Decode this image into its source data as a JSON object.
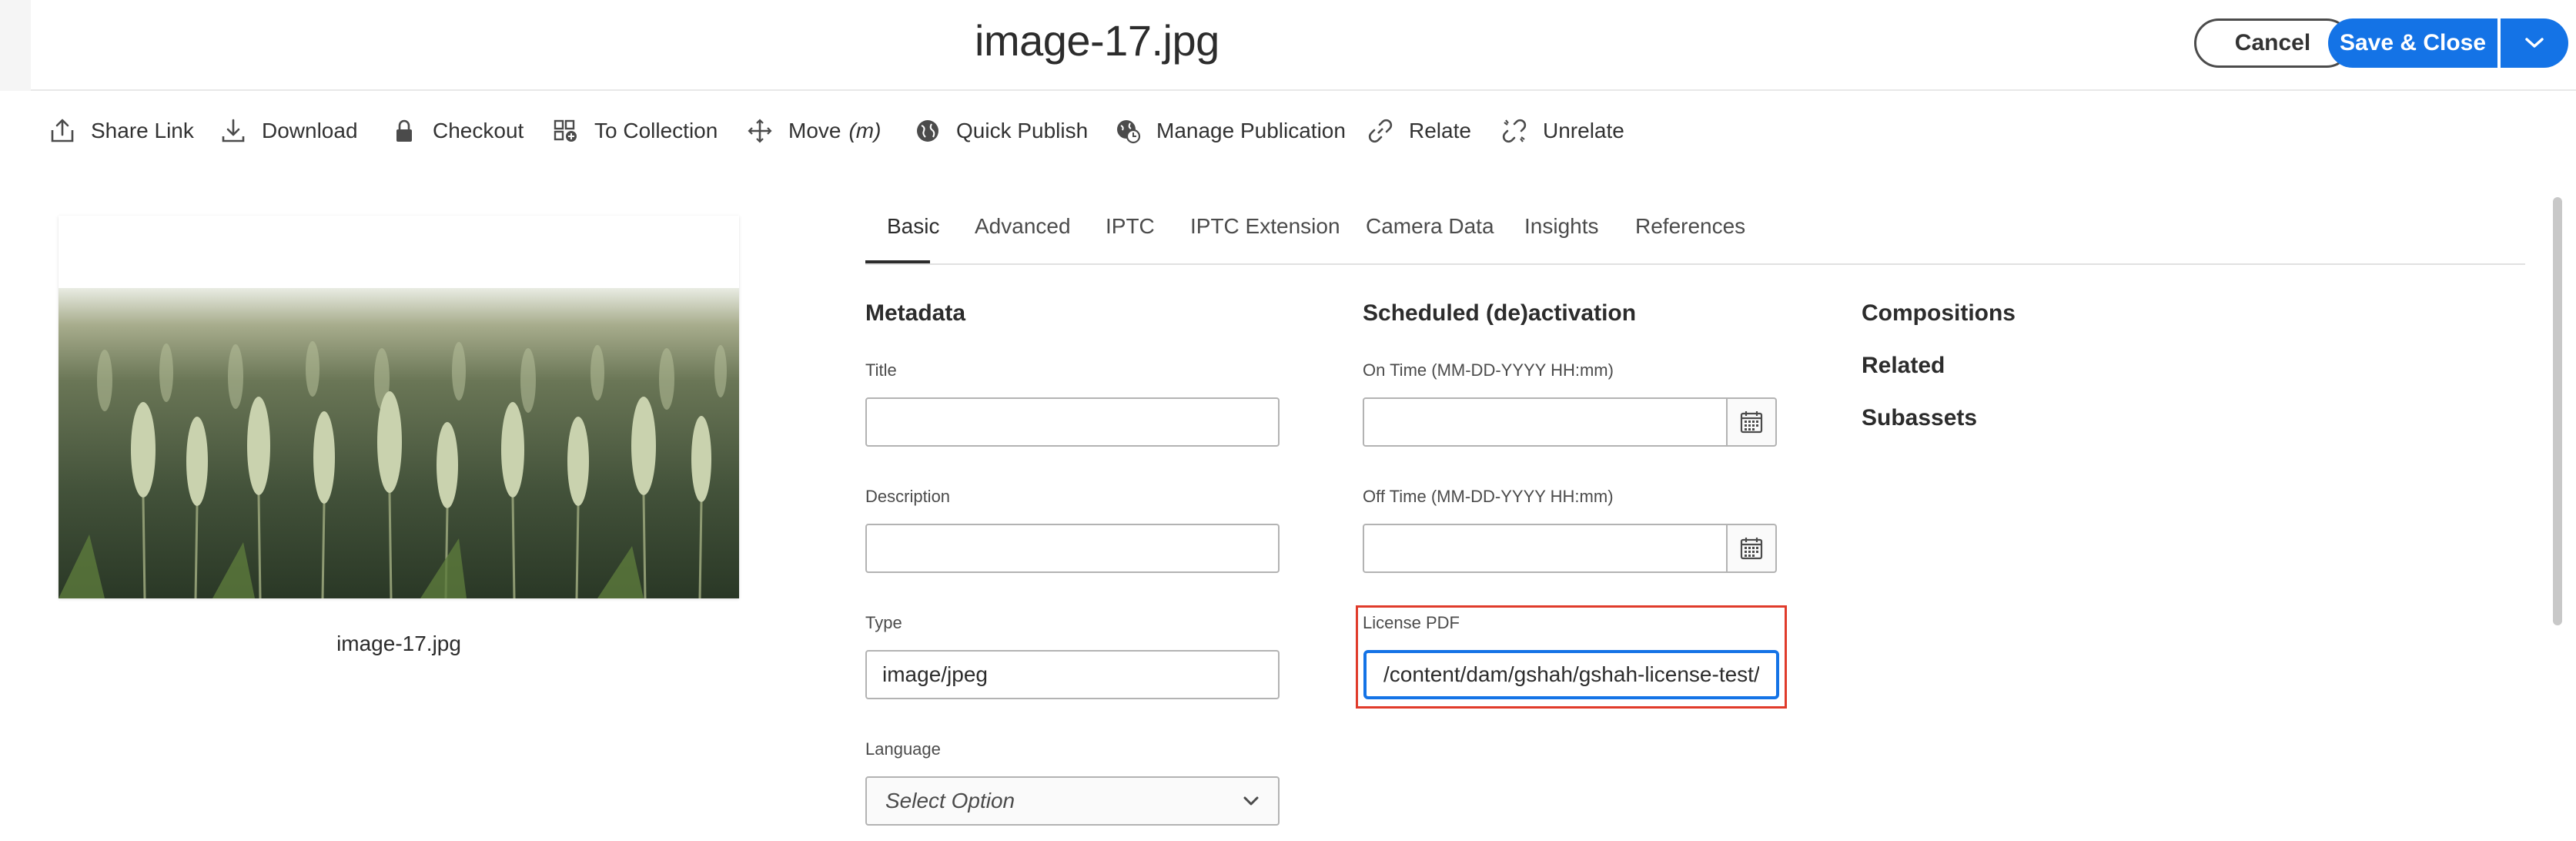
{
  "header": {
    "title": "image-17.jpg",
    "cancel_label": "Cancel",
    "save_label": "Save & Close"
  },
  "toolbar": {
    "items": [
      {
        "label": "Share Link",
        "icon": "share-icon"
      },
      {
        "label": "Download",
        "icon": "download-icon"
      },
      {
        "label": "Checkout",
        "icon": "lock-icon"
      },
      {
        "label": "To Collection",
        "icon": "collection-icon"
      },
      {
        "label": "Move",
        "shortcut": "(m)",
        "icon": "move-icon"
      },
      {
        "label": "Quick Publish",
        "icon": "globe-icon"
      },
      {
        "label": "Manage Publication",
        "icon": "globe-clock-icon"
      },
      {
        "label": "Relate",
        "icon": "link-icon"
      },
      {
        "label": "Unrelate",
        "icon": "unlink-icon"
      }
    ]
  },
  "preview": {
    "caption": "image-17.jpg"
  },
  "tabs": [
    {
      "label": "Basic",
      "active": true
    },
    {
      "label": "Advanced"
    },
    {
      "label": "IPTC"
    },
    {
      "label": "IPTC Extension"
    },
    {
      "label": "Camera Data"
    },
    {
      "label": "Insights"
    },
    {
      "label": "References"
    }
  ],
  "metadata": {
    "section_title": "Metadata",
    "title_label": "Title",
    "title_value": "",
    "description_label": "Description",
    "description_value": "",
    "type_label": "Type",
    "type_value": "image/jpeg",
    "language_label": "Language",
    "language_placeholder": "Select Option"
  },
  "scheduling": {
    "section_title": "Scheduled (de)activation",
    "on_time_label": "On Time (MM-DD-YYYY HH:mm)",
    "on_time_value": "",
    "off_time_label": "Off Time (MM-DD-YYYY HH:mm)",
    "off_time_value": "",
    "license_label": "License PDF",
    "license_value": "/content/dam/gshah/gshah-license-test/gshah-license.pdf"
  },
  "side_links": [
    "Compositions",
    "Related",
    "Subassets"
  ],
  "colors": {
    "accent": "#1473e6",
    "highlight": "#e03b2b"
  }
}
